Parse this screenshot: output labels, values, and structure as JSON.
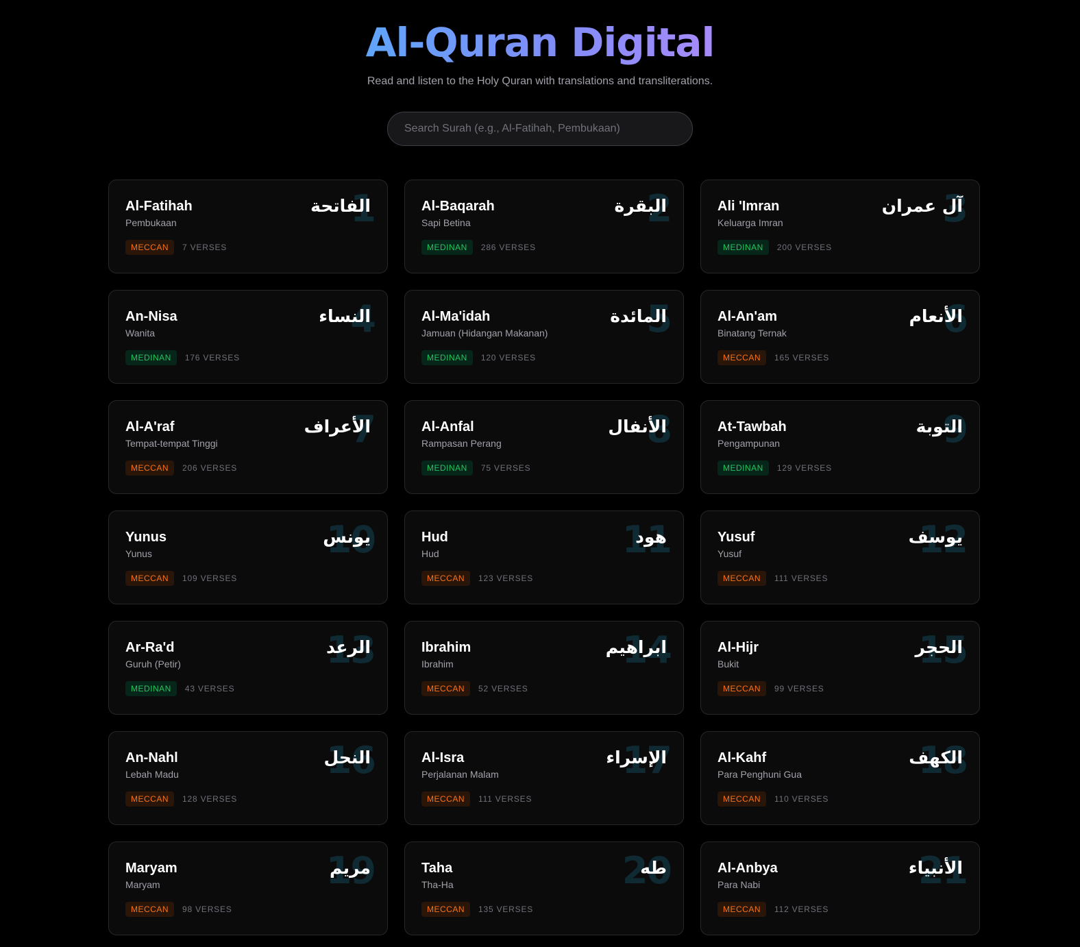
{
  "header": {
    "title": "Al-Quran Digital",
    "subtitle": "Read and listen to the Holy Quran with translations and transliterations."
  },
  "search": {
    "placeholder": "Search Surah (e.g., Al-Fatihah, Pembukaan)",
    "value": ""
  },
  "colors": {
    "background": "#000000",
    "card": "#0b0b0c",
    "meccan": "#f97316",
    "medinan": "#22c55e",
    "title_gradient_start": "#60a5fa",
    "title_gradient_end": "#a78bfa"
  },
  "surahs": [
    {
      "number": "1",
      "name": "Al-Fatihah",
      "translation": "Pembukaan",
      "arabic": "الفاتحة",
      "type": "MECCAN",
      "verses": "7 VERSES"
    },
    {
      "number": "2",
      "name": "Al-Baqarah",
      "translation": "Sapi Betina",
      "arabic": "البقرة",
      "type": "MEDINAN",
      "verses": "286 VERSES"
    },
    {
      "number": "3",
      "name": "Ali 'Imran",
      "translation": "Keluarga Imran",
      "arabic": "آل عمران",
      "type": "MEDINAN",
      "verses": "200 VERSES"
    },
    {
      "number": "4",
      "name": "An-Nisa",
      "translation": "Wanita",
      "arabic": "النساء",
      "type": "MEDINAN",
      "verses": "176 VERSES"
    },
    {
      "number": "5",
      "name": "Al-Ma'idah",
      "translation": "Jamuan (Hidangan Makanan)",
      "arabic": "المائدة",
      "type": "MEDINAN",
      "verses": "120 VERSES"
    },
    {
      "number": "6",
      "name": "Al-An'am",
      "translation": "Binatang Ternak",
      "arabic": "الأنعام",
      "type": "MECCAN",
      "verses": "165 VERSES"
    },
    {
      "number": "7",
      "name": "Al-A'raf",
      "translation": "Tempat-tempat Tinggi",
      "arabic": "الأعراف",
      "type": "MECCAN",
      "verses": "206 VERSES"
    },
    {
      "number": "8",
      "name": "Al-Anfal",
      "translation": "Rampasan Perang",
      "arabic": "الأنفال",
      "type": "MEDINAN",
      "verses": "75 VERSES"
    },
    {
      "number": "9",
      "name": "At-Tawbah",
      "translation": "Pengampunan",
      "arabic": "التوبة",
      "type": "MEDINAN",
      "verses": "129 VERSES"
    },
    {
      "number": "10",
      "name": "Yunus",
      "translation": "Yunus",
      "arabic": "يونس",
      "type": "MECCAN",
      "verses": "109 VERSES"
    },
    {
      "number": "11",
      "name": "Hud",
      "translation": "Hud",
      "arabic": "هود",
      "type": "MECCAN",
      "verses": "123 VERSES"
    },
    {
      "number": "12",
      "name": "Yusuf",
      "translation": "Yusuf",
      "arabic": "يوسف",
      "type": "MECCAN",
      "verses": "111 VERSES"
    },
    {
      "number": "13",
      "name": "Ar-Ra'd",
      "translation": "Guruh (Petir)",
      "arabic": "الرعد",
      "type": "MEDINAN",
      "verses": "43 VERSES"
    },
    {
      "number": "14",
      "name": "Ibrahim",
      "translation": "Ibrahim",
      "arabic": "ابراهيم",
      "type": "MECCAN",
      "verses": "52 VERSES"
    },
    {
      "number": "15",
      "name": "Al-Hijr",
      "translation": "Bukit",
      "arabic": "الحجر",
      "type": "MECCAN",
      "verses": "99 VERSES"
    },
    {
      "number": "16",
      "name": "An-Nahl",
      "translation": "Lebah Madu",
      "arabic": "النحل",
      "type": "MECCAN",
      "verses": "128 VERSES"
    },
    {
      "number": "17",
      "name": "Al-Isra",
      "translation": "Perjalanan Malam",
      "arabic": "الإسراء",
      "type": "MECCAN",
      "verses": "111 VERSES"
    },
    {
      "number": "18",
      "name": "Al-Kahf",
      "translation": "Para Penghuni Gua",
      "arabic": "الكهف",
      "type": "MECCAN",
      "verses": "110 VERSES"
    },
    {
      "number": "19",
      "name": "Maryam",
      "translation": "Maryam",
      "arabic": "مريم",
      "type": "MECCAN",
      "verses": "98 VERSES"
    },
    {
      "number": "20",
      "name": "Taha",
      "translation": "Tha-Ha",
      "arabic": "طه",
      "type": "MECCAN",
      "verses": "135 VERSES"
    },
    {
      "number": "21",
      "name": "Al-Anbya",
      "translation": "Para Nabi",
      "arabic": "الأنبياء",
      "type": "MECCAN",
      "verses": "112 VERSES"
    }
  ]
}
